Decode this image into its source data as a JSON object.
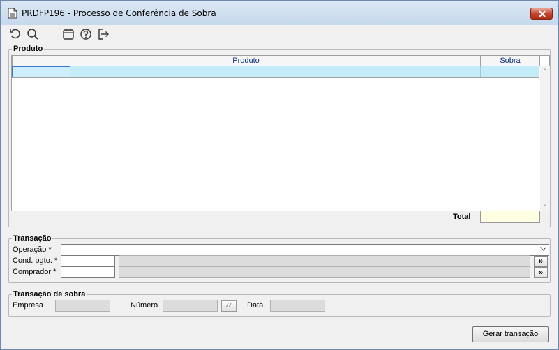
{
  "window": {
    "title": "PRDFP196 - Processo de Conferência de Sobra"
  },
  "toolbar": {
    "icons": [
      "refresh-icon",
      "search-icon",
      "calendar-icon",
      "help-icon",
      "exit-icon"
    ]
  },
  "produto_group": {
    "label": "Produto",
    "columns": [
      "Produto",
      "Sobra"
    ],
    "rows": [
      {
        "code": "",
        "produto": "",
        "sobra": ""
      }
    ],
    "total_label": "Total",
    "total_value": ""
  },
  "transacao_group": {
    "label": "Transação",
    "operacao_label": "Operação *",
    "operacao_value": "",
    "cond_pgto_label": "Cond. pgto. *",
    "cond_pgto_value": "",
    "cond_pgto_desc": "",
    "comprador_label": "Comprador *",
    "comprador_value": "",
    "comprador_desc": "",
    "lookup_glyph": "»"
  },
  "sobra_group": {
    "label": "Transação de sobra",
    "empresa_label": "Empresa",
    "empresa_value": "",
    "numero_label": "Número",
    "numero_value": "",
    "data_label": "Data",
    "data_value": ""
  },
  "actions": {
    "gerar_first": "G",
    "gerar_rest": "erar transação"
  },
  "colors": {
    "row_highlight": "#c3ecf8",
    "total_field": "#ffffe1",
    "header_text": "#0b2f8a"
  }
}
